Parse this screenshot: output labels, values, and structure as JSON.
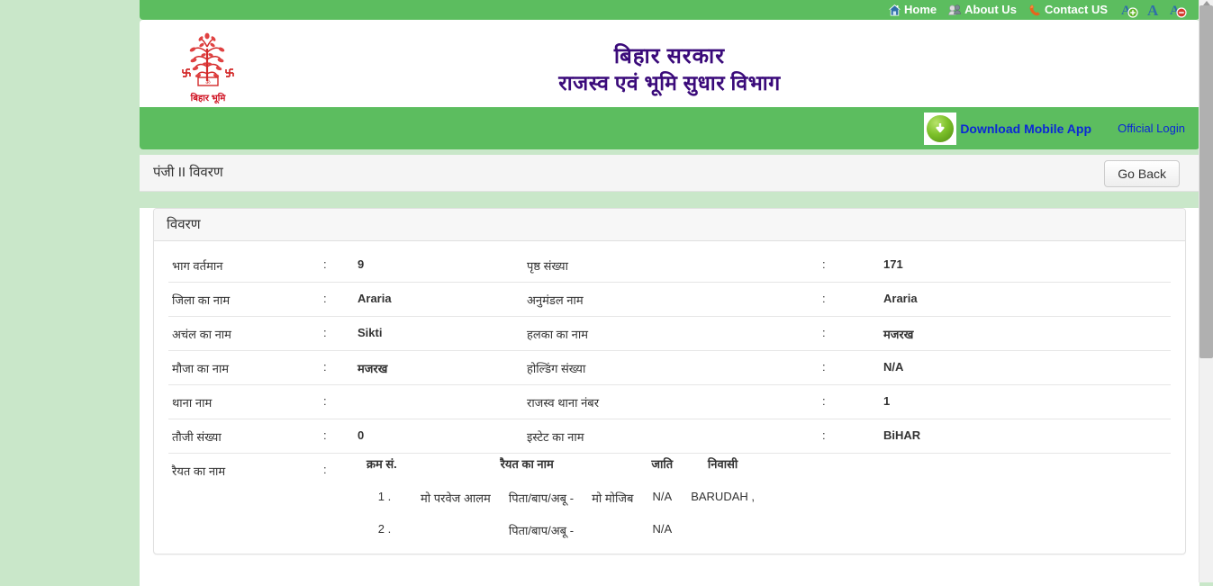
{
  "topbar": {
    "links": [
      {
        "label": "Home",
        "icon": "home-icon"
      },
      {
        "label": "About Us",
        "icon": "users-icon"
      },
      {
        "label": "Contact US",
        "icon": "phone-icon"
      }
    ],
    "font_buttons": [
      {
        "name": "font-increase-icon",
        "glyph": "A",
        "badge": "+"
      },
      {
        "name": "font-normal-icon",
        "glyph": "A",
        "badge": ""
      },
      {
        "name": "font-decrease-icon",
        "glyph": "A",
        "badge": "−"
      }
    ]
  },
  "header": {
    "logo_caption": "बिहार भूमि",
    "title_line1": "बिहार सरकार",
    "title_line2": "राजस्व एवं भूमि सुधार विभाग"
  },
  "greenstrip": {
    "download_label": "Download Mobile App",
    "official_login": "Official Login"
  },
  "crumb": {
    "text": "पंजी II विवरण",
    "go_back": "Go Back"
  },
  "panel": {
    "heading": "विवरण",
    "rows": [
      {
        "label": "भाग वर्तमान",
        "colon": ":",
        "value": "9",
        "label2": "पृष्ठ संख्या",
        "colon2": ":",
        "value2": "171"
      },
      {
        "label": "जिला का नाम",
        "colon": ":",
        "value": "Araria",
        "label2": "अनुमंडल नाम",
        "colon2": ":",
        "value2": "Araria"
      },
      {
        "label": "अचंल का नाम",
        "colon": ":",
        "value": "Sikti",
        "label2": "हलका का नाम",
        "colon2": ":",
        "value2": "मजरख"
      },
      {
        "label": "मौजा का नाम",
        "colon": ":",
        "value": "मजरख",
        "label2": "होल्डिंग संख्या",
        "colon2": ":",
        "value2": "N/A"
      },
      {
        "label": "थाना नाम",
        "colon": ":",
        "value": "",
        "label2": "राजस्व थाना नंबर",
        "colon2": ":",
        "value2": "1"
      },
      {
        "label": "तौजी संख्या",
        "colon": ":",
        "value": "0",
        "label2": "इस्टेट का नाम",
        "colon2": ":",
        "value2": "BiHAR"
      }
    ],
    "raiyat": {
      "label": "रैयत का नाम",
      "colon": ":",
      "headers": [
        "क्रम सं.",
        "रैयत का नाम",
        "जाति",
        "निवासी"
      ],
      "rows": [
        {
          "sr": "1 .",
          "name": "मो परवेज आलम",
          "relation": "पिता/बाप/अबू -",
          "father": "मो मोजिब",
          "caste": "N/A",
          "residence": "BARUDAH ,"
        },
        {
          "sr": "2 .",
          "name": "",
          "relation": "पिता/बाप/अबू -",
          "father": "",
          "caste": "N/A",
          "residence": ""
        }
      ]
    }
  },
  "colors": {
    "page_background": "#c9e7c9",
    "green_bar": "#5cbd5f",
    "title_purple": "#3a0a7a",
    "logo_red": "#cf1020",
    "link_blue": "#0a28d6"
  }
}
